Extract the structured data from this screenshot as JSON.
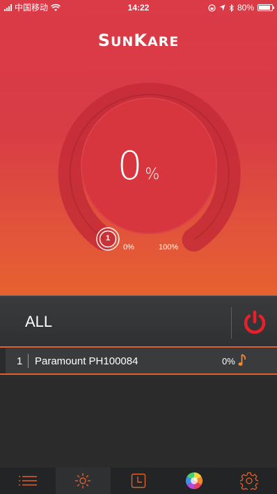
{
  "status_bar": {
    "carrier": "中国移动",
    "time": "14:22",
    "battery_pct": "80%"
  },
  "brand": {
    "logo_big1": "S",
    "logo_small1": "UN",
    "logo_big2": "K",
    "logo_small2": "ARE"
  },
  "dial": {
    "value": "0",
    "unit": "%",
    "knob_number": "1",
    "min_label": "0%",
    "max_label": "100%",
    "level_fraction": 0
  },
  "group": {
    "label": "ALL"
  },
  "devices": [
    {
      "index": "1",
      "name": "Paramount  PH100084",
      "percent": "0%"
    }
  ],
  "colors": {
    "accent": "#e0612f",
    "power_red": "#e8202a",
    "hero_top": "#db3a47",
    "hero_bottom": "#e6612f"
  },
  "tabs": [
    {
      "icon": "list-icon",
      "active": false
    },
    {
      "icon": "sun-icon",
      "active": true
    },
    {
      "icon": "clock-icon",
      "active": false
    },
    {
      "icon": "color-wheel-icon",
      "active": false
    },
    {
      "icon": "gear-icon",
      "active": false
    }
  ]
}
